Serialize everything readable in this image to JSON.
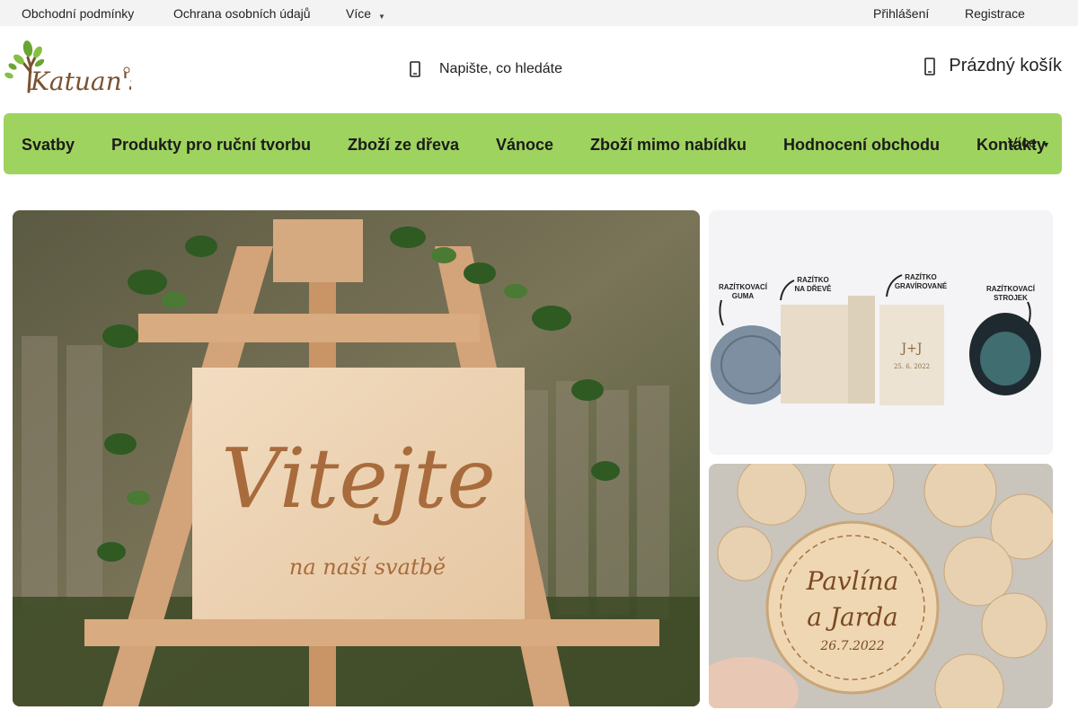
{
  "topbar": {
    "links": [
      "Obchodní podmínky",
      "Ochrana osobních údajů",
      "Více"
    ],
    "login": "Přihlášení",
    "register": "Registrace"
  },
  "logo": {
    "text": "Katuan's"
  },
  "search": {
    "placeholder": "Napište, co hledáte",
    "icon": "search-icon"
  },
  "cart": {
    "label": "Prázdný košík",
    "icon": "cart-icon"
  },
  "nav": {
    "items": [
      "Svatby",
      "Produkty pro ruční tvorbu",
      "Zboží ze dřeva",
      "Vánoce",
      "Zboží mimo nabídku",
      "Hodnocení obchodu",
      "Kontakty"
    ],
    "more": "Více"
  },
  "banners": {
    "main": {
      "line1": "Vitejte",
      "line2": "na naší svatbě"
    },
    "stamps": {
      "labels": [
        {
          "top": "RAZÍTKOVACÍ",
          "bottom": "GUMA"
        },
        {
          "top": "RAZÍTKO",
          "bottom": "NA DŘEVĚ"
        },
        {
          "top": "RAZÍTKO",
          "bottom": "GRAVÍROVANÉ"
        },
        {
          "top": "RAZÍTKOVACÍ",
          "bottom": "STROJEK"
        }
      ],
      "stamp_text": "J+J",
      "stamp_date": "25. 6. 2022"
    },
    "magnets": {
      "name1": "Pavlína",
      "name2": "a Jarda",
      "date": "26.7.2022"
    }
  },
  "colors": {
    "nav_green": "#9ed35f",
    "topbar_bg": "#f3f3f3",
    "logo_green": "#6aa534",
    "logo_brown": "#7a5230"
  }
}
